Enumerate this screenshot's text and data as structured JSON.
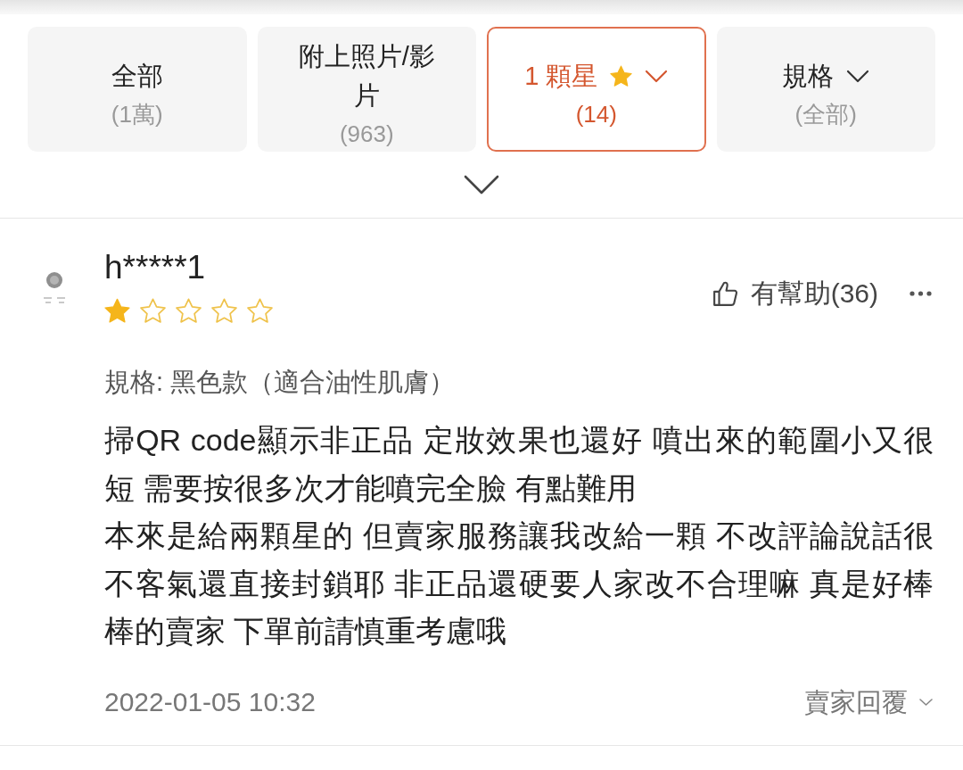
{
  "filter_tabs": [
    {
      "label": "全部",
      "count": "(1萬)",
      "selected": false,
      "kind": "plain"
    },
    {
      "label": "附上照片/影片",
      "count": "(963)",
      "selected": false,
      "kind": "plain"
    },
    {
      "label": "1 顆星",
      "count": "(14)",
      "selected": true,
      "kind": "rating"
    },
    {
      "label": "規格",
      "count": "(全部)",
      "selected": false,
      "kind": "dropdown"
    }
  ],
  "review": {
    "user": "h*****1",
    "stars": 1,
    "helpful": "有幫助(36)",
    "variation": "規格: 黑色款（適合油性肌膚）",
    "comment": [
      "掃QR code顯示非正品 定妝效果也還好 噴出來的範圍小又很短 需要按很多次才能噴完全臉 有點難用",
      "本來是給兩顆星的 但賣家服務讓我改給一顆 不改評論說話很不客氣還直接封鎖耶 非正品還硬要人家改不合理嘛 真是好棒棒的賣家 下單前請慎重考慮哦"
    ],
    "date": "2022-01-05 10:32",
    "seller_reply": "賣家回覆"
  }
}
